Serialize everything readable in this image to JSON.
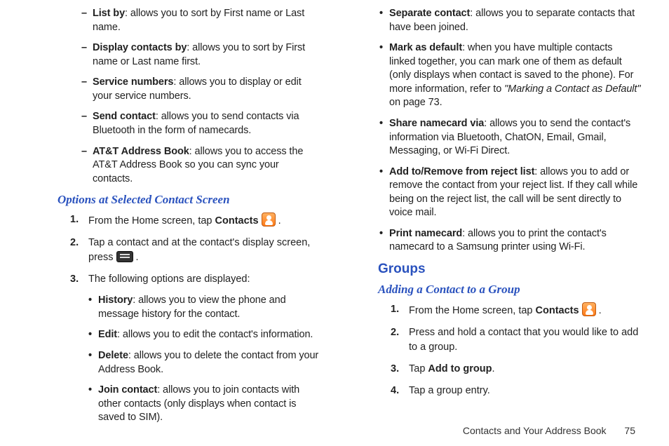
{
  "left": {
    "dashes": [
      {
        "lead": "List by",
        "rest": ": allows you to sort by First name or Last name."
      },
      {
        "lead": "Display contacts by",
        "rest": ": allows you to sort by First name or Last name first."
      },
      {
        "lead": "Service numbers",
        "rest": ": allows you to display or edit your service numbers."
      },
      {
        "lead": "Send contact",
        "rest": ": allows you to send contacts via Bluetooth in the form of namecards."
      },
      {
        "lead": "AT&T Address Book",
        "rest": ": allows you to access the AT&T Address Book so you can sync your contacts."
      }
    ],
    "heading_options": "Options at Selected Contact Screen",
    "step1_a": "From the Home screen, tap ",
    "step1_bold": "Contacts",
    "step1_b": " ",
    "step1_c": " .",
    "step2_a": "Tap a contact and at the contact's display screen, press ",
    "step2_b": " .",
    "step3": "The following options are displayed:",
    "bullets": [
      {
        "lead": "History",
        "rest": ": allows you to view the phone and message history for the contact."
      },
      {
        "lead": "Edit",
        "rest": ": allows you to edit the contact's information."
      },
      {
        "lead": "Delete",
        "rest": ": allows you to delete the contact from your Address Book."
      },
      {
        "lead": "Join contact",
        "rest": ": allows you to join contacts with other contacts (only displays when contact is saved to SIM)."
      }
    ]
  },
  "right": {
    "bullets": [
      {
        "lead": "Separate contact",
        "rest": ": allows you to separate contacts that have been joined."
      },
      {
        "lead": "Mark as default",
        "rest": ": when you have multiple contacts linked together, you can mark one of them as default (only displays when contact is saved to the phone). For more information, refer to ",
        "italic": "\"Marking a Contact as Default\"",
        "tail": "  on page 73."
      },
      {
        "lead": "Share namecard via",
        "rest": ": allows you to send the contact's information via Bluetooth, ChatON, Email, Gmail, Messaging, or Wi-Fi Direct."
      },
      {
        "lead": "Add to/Remove from reject list",
        "rest": ": allows you to add or remove the contact from your reject list. If they call while being on the reject list, the call will be sent directly to voice mail."
      },
      {
        "lead": "Print namecard",
        "rest": ": allows you to print the contact's namecard to a Samsung printer using Wi-Fi."
      }
    ],
    "section_groups": "Groups",
    "heading_adding": "Adding a Contact to a Group",
    "gstep1_a": "From the Home screen, tap ",
    "gstep1_bold": "Contacts",
    "gstep1_b": " ",
    "gstep1_c": " .",
    "gstep2": "Press and hold a contact that you would like to add to a group.",
    "gstep3_a": "Tap ",
    "gstep3_bold": "Add to group",
    "gstep3_b": ".",
    "gstep4": "Tap a group entry."
  },
  "footer": {
    "title": "Contacts and Your Address Book",
    "page": "75"
  }
}
